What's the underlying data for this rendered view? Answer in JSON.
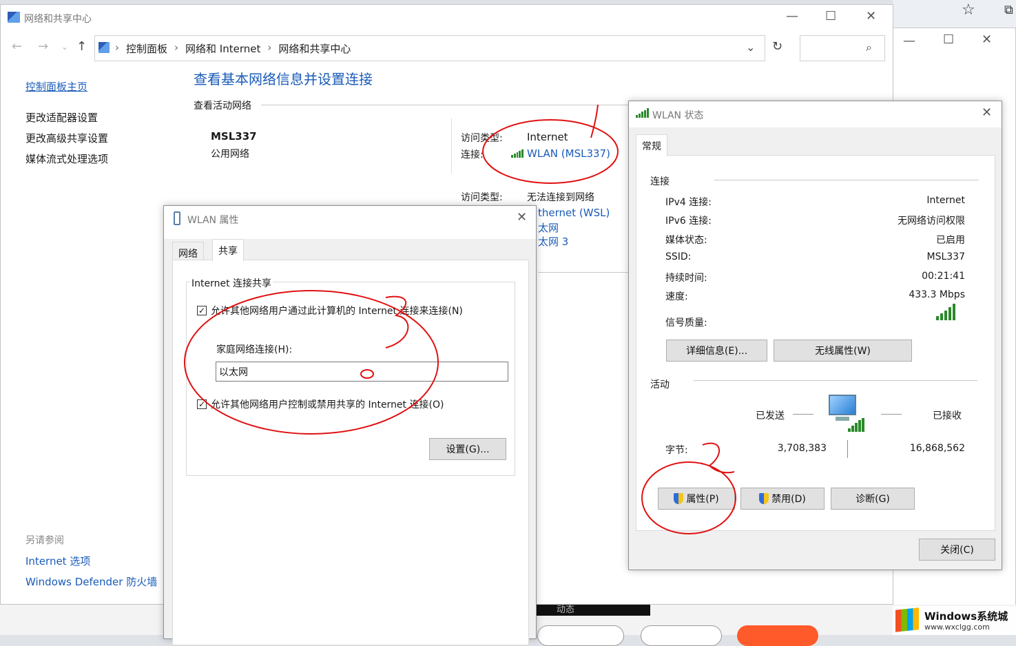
{
  "main_window": {
    "title": "网络和共享中心",
    "breadcrumb": [
      "控制面板",
      "网络和 Internet",
      "网络和共享中心"
    ],
    "sidebar_home": "控制面板主页",
    "sidebar_items": [
      "更改适配器设置",
      "更改高级共享设置",
      "媒体流式处理选项"
    ],
    "see_also_title": "另请参阅",
    "see_also_items": [
      "Internet 选项",
      "Windows Defender 防火墙"
    ],
    "heading": "查看基本网络信息并设置连接",
    "active_networks_label": "查看活动网络",
    "network1_name": "MSL337",
    "network1_type": "公用网络",
    "access_type_label": "访问类型:",
    "access_type_value": "Internet",
    "connection_label": "连接:",
    "connection_link": "WLAN (MSL337)",
    "access_type2_value": "无法连接到网络",
    "connections2": [
      "thernet (WSL)",
      "太网",
      "太网 3"
    ]
  },
  "bg_window": {
    "fragment_text": "动态"
  },
  "wlan_properties": {
    "title": "WLAN 属性",
    "tabs": [
      "网络",
      "共享"
    ],
    "group_title": "Internet 连接共享",
    "check1": "允许其他网络用户通过此计算机的 Internet 连接来连接(N)",
    "home_conn_label": "家庭网络连接(H):",
    "home_conn_value": "以太网",
    "check2": "允许其他网络用户控制或禁用共享的 Internet 连接(O)",
    "settings_button": "设置(G)..."
  },
  "wlan_status": {
    "title": "WLAN 状态",
    "tab": "常规",
    "connection_section": "连接",
    "rows": [
      {
        "label": "IPv4 连接:",
        "value": "Internet"
      },
      {
        "label": "IPv6 连接:",
        "value": "无网络访问权限"
      },
      {
        "label": "媒体状态:",
        "value": "已启用"
      },
      {
        "label": "SSID:",
        "value": "MSL337"
      },
      {
        "label": "持续时间:",
        "value": "00:21:41"
      },
      {
        "label": "速度:",
        "value": "433.3 Mbps"
      }
    ],
    "signal_label": "信号质量:",
    "details_button": "详细信息(E)...",
    "wireless_props_button": "无线属性(W)",
    "activity_section": "活动",
    "sent_label": "已发送",
    "received_label": "已接收",
    "bytes_label": "字节:",
    "bytes_sent": "3,708,383",
    "bytes_received": "16,868,562",
    "properties_button": "属性(P)",
    "disable_button": "禁用(D)",
    "diagnose_button": "诊断(G)",
    "close_button": "关闭(C)"
  },
  "watermark": {
    "brand": "Windows系统城",
    "url": "www.wxclgg.com"
  },
  "colors": {
    "link": "#1a5bb8",
    "heading": "#1a5bb8",
    "annotation": "#e01010"
  }
}
